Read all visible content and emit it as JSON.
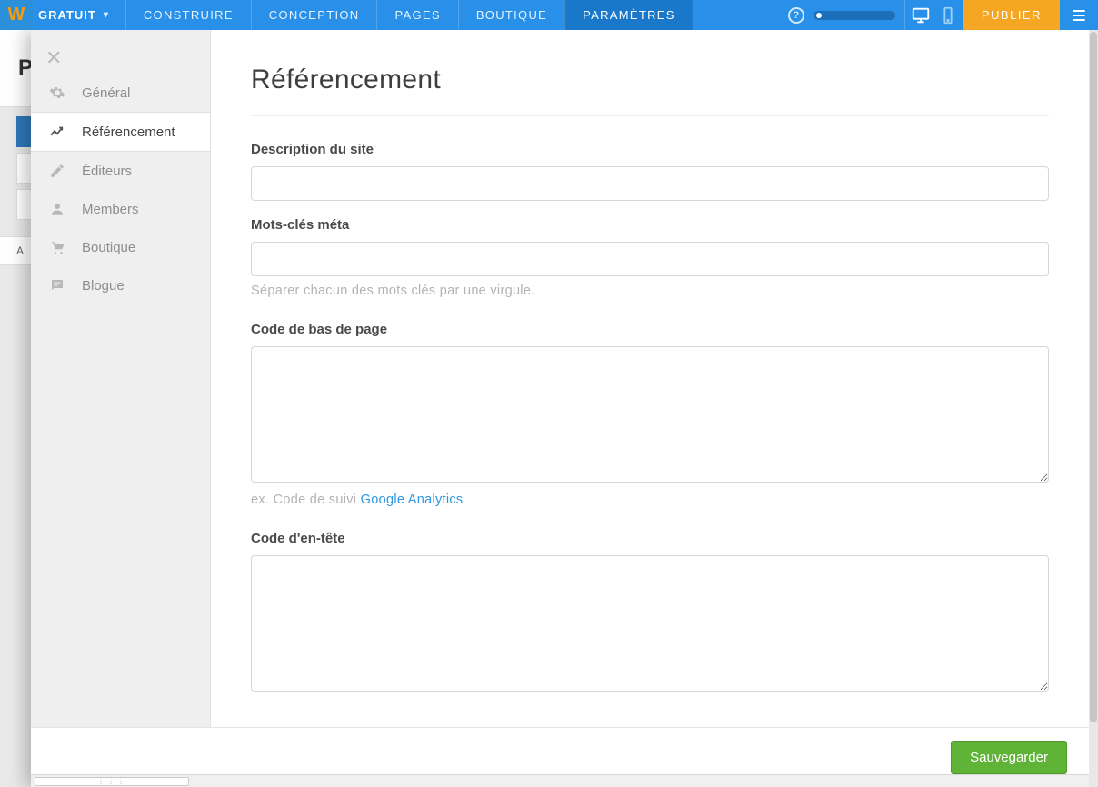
{
  "topbar": {
    "plan_label": "GRATUIT",
    "tabs": [
      "CONSTRUIRE",
      "CONCEPTION",
      "PAGES",
      "BOUTIQUE",
      "PARAMÈTRES"
    ],
    "active_tab_index": 4,
    "publish_label": "PUBLIER"
  },
  "bg": {
    "page_letter": "P",
    "left_label": "A"
  },
  "sidebar": {
    "items": [
      {
        "label": "Général",
        "icon": "gear-icon"
      },
      {
        "label": "Référencement",
        "icon": "trend-icon"
      },
      {
        "label": "Éditeurs",
        "icon": "pencil-icon"
      },
      {
        "label": "Members",
        "icon": "person-icon"
      },
      {
        "label": "Boutique",
        "icon": "cart-icon"
      },
      {
        "label": "Blogue",
        "icon": "chat-icon"
      }
    ],
    "active_index": 1
  },
  "content": {
    "title": "Référencement",
    "site_desc_label": "Description du site",
    "site_desc_value": "",
    "meta_kw_label": "Mots-clés méta",
    "meta_kw_value": "",
    "meta_kw_hint": "Séparer chacun des mots clés par une virgule.",
    "footer_code_label": "Code de bas de page",
    "footer_code_value": "",
    "footer_code_hint_prefix": "ex. Code de suivi ",
    "footer_code_hint_link": "Google Analytics",
    "header_code_label": "Code d'en-tête",
    "header_code_value": ""
  },
  "footer": {
    "save_label": "Sauvegarder"
  }
}
